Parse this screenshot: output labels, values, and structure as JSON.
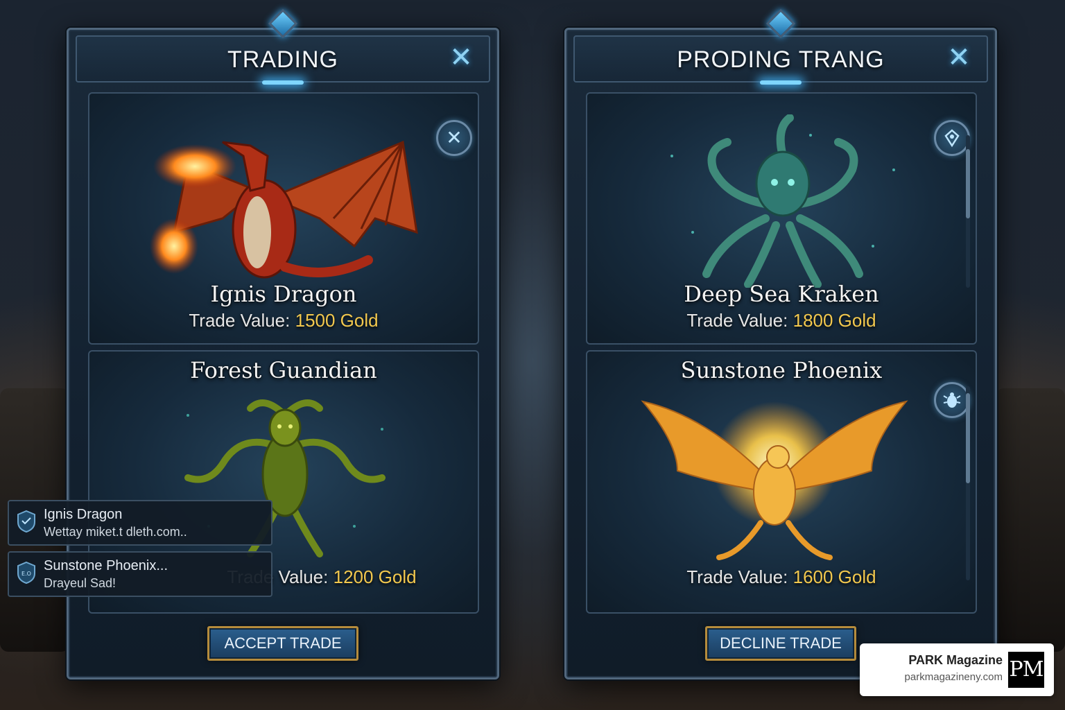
{
  "left_panel": {
    "title": "TRADING",
    "close_glyph": "✕",
    "cards": [
      {
        "name": "Ignis Dragon",
        "trade_label": "Trade Value:",
        "trade_value": "1500 Gold",
        "badge_icon": "cross-swords-icon",
        "badge_glyph": "✕"
      },
      {
        "name": "Forest Guandian",
        "trade_label": "Trade Value:",
        "trade_value": "1200 Gold"
      }
    ],
    "action_button": "ACCEPT TRADE"
  },
  "right_panel": {
    "title": "PRODING TRANG",
    "close_glyph": "✕",
    "cards": [
      {
        "name": "Deep Sea Kraken",
        "trade_label": "Trade Value:",
        "trade_value": "1800 Gold",
        "badge_icon": "emblem-icon"
      },
      {
        "name": "Sunstone Phoenix",
        "trade_label": "Trade Value:",
        "trade_value": "1600 Gold",
        "badge_icon": "beetle-icon"
      }
    ],
    "action_button": "DECLINE TRADE"
  },
  "notifications": [
    {
      "title": "Ignis Dragon",
      "subtitle": "Wettay miket.t dleth.com..",
      "icon": "shield-icon"
    },
    {
      "title": "Sunstone Phoenix...",
      "subtitle": "Drayeul Sad!",
      "icon": "shield-icon",
      "icon_text": "E.O"
    }
  ],
  "watermark": {
    "name": "PARK Magazine",
    "url": "parkmagazineny.com",
    "logo": "PM"
  },
  "colors": {
    "gold": "#f2c84e",
    "button_border": "#b58c3c",
    "panel_border": "#51677d",
    "accent_glow": "#3fa8e8"
  }
}
